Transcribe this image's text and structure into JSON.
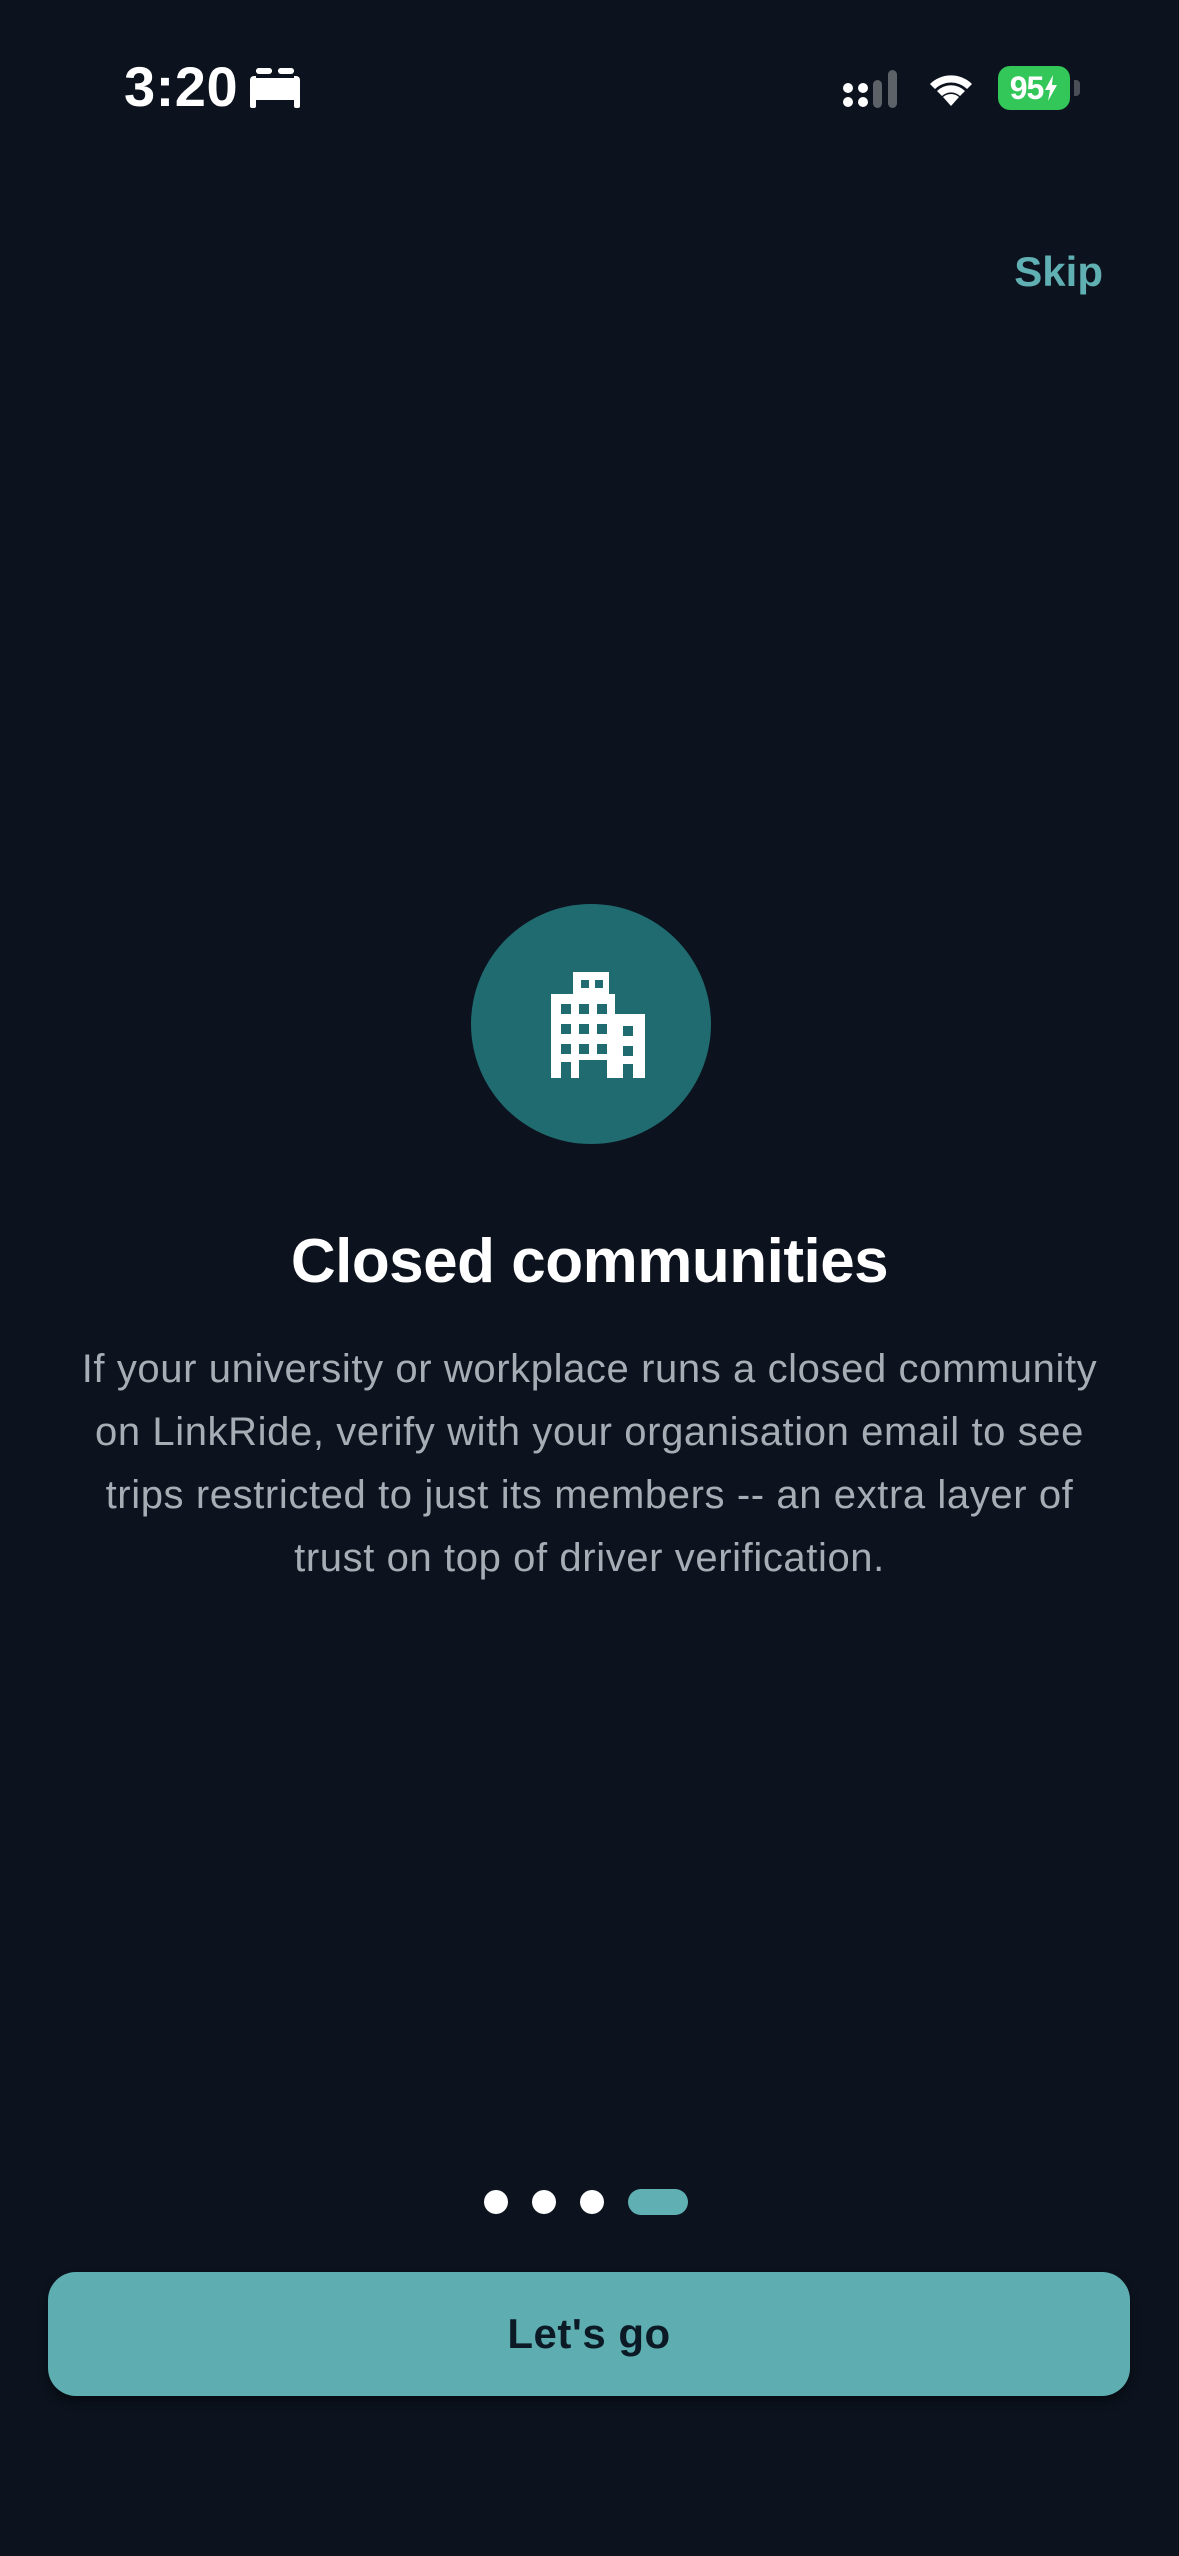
{
  "status_bar": {
    "time": "3:20",
    "focus_icon": "bed-icon",
    "signal_icon": "cellular-signal-icon",
    "wifi_icon": "wifi-icon",
    "battery_level": "95",
    "battery_charging": true,
    "battery_color": "#33c759"
  },
  "header": {
    "skip_label": "Skip"
  },
  "slide": {
    "icon": "building-icon",
    "icon_bg_color": "#1f6b70",
    "title": "Closed communities",
    "description": "If your university or workplace runs a closed community on LinkRide, verify with your organisation email to see trips restricted to just its members -- an extra layer of trust on top of driver verification."
  },
  "pagination": {
    "total": 4,
    "current": 4
  },
  "cta": {
    "label": "Let's go",
    "color": "#5eaeb1"
  },
  "colors": {
    "background": "#0c131e",
    "accent": "#5fafb3"
  }
}
